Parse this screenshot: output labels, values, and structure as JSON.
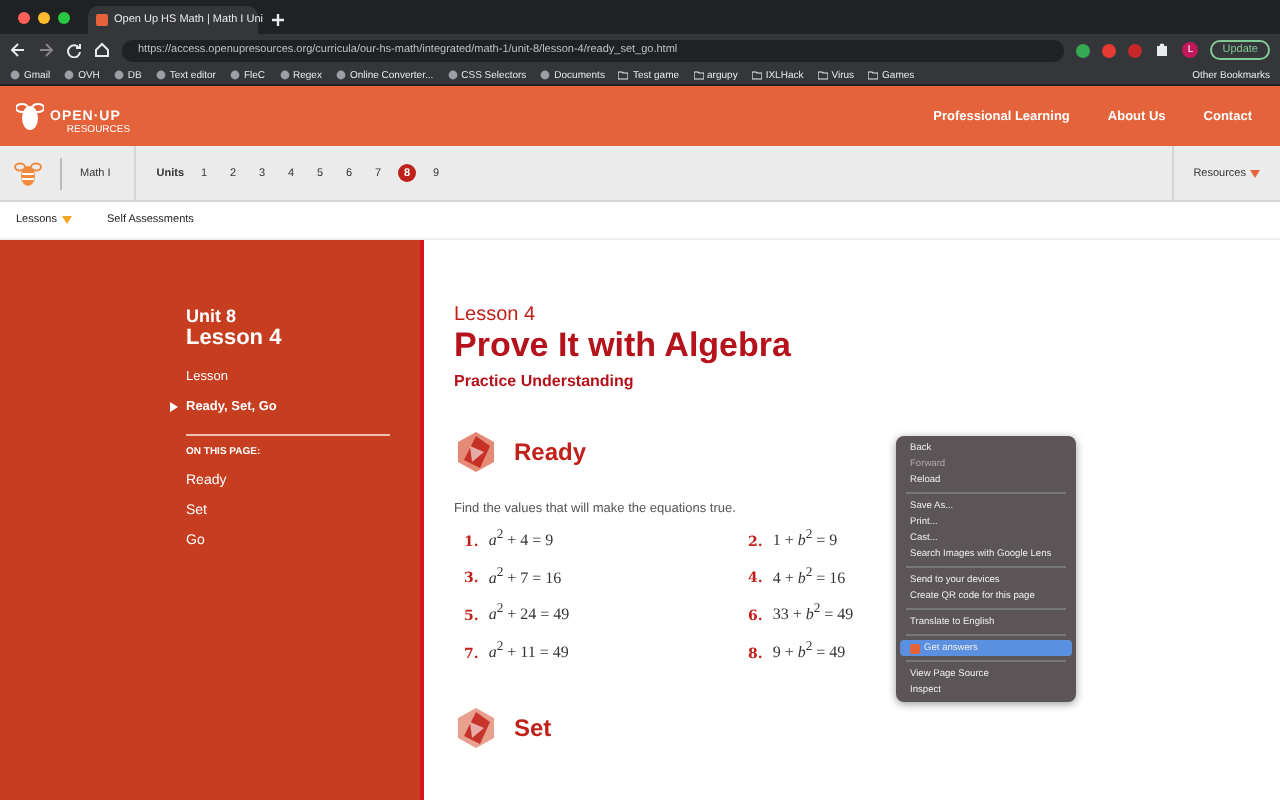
{
  "browser": {
    "tab_title": "Open Up HS Math | Math I Uni",
    "url": "https://access.openupresources.org/curricula/our-hs-math/integrated/math-1/unit-8/lesson-4/ready_set_go.html",
    "update_label": "Update",
    "profile": "L"
  },
  "bookmarks": [
    {
      "label": "Gmail"
    },
    {
      "label": "OVH"
    },
    {
      "label": "DB"
    },
    {
      "label": "Text editor"
    },
    {
      "label": "FleC"
    },
    {
      "label": "Regex"
    },
    {
      "label": "Online Converter..."
    },
    {
      "label": "CSS Selectors"
    },
    {
      "label": "Documents"
    },
    {
      "label": "Test game",
      "kind": "folder"
    },
    {
      "label": "argupy",
      "kind": "folder"
    },
    {
      "label": "IXLHack",
      "kind": "folder"
    },
    {
      "label": "Virus",
      "kind": "folder"
    },
    {
      "label": "Games",
      "kind": "folder"
    }
  ],
  "other_bookmarks": "Other Bookmarks",
  "header": {
    "logo": "OPEN·UP",
    "logo_sub": "RESOURCES",
    "nav": [
      "Professional Learning",
      "About Us",
      "Contact"
    ]
  },
  "course": {
    "name": "Math I",
    "units_label": "Units",
    "units": [
      {
        "label": "1",
        "selected": false
      },
      {
        "label": "2",
        "selected": false
      },
      {
        "label": "3",
        "selected": false
      },
      {
        "label": "4",
        "selected": false
      },
      {
        "label": "5",
        "selected": false
      },
      {
        "label": "6",
        "selected": false
      },
      {
        "label": "7",
        "selected": false
      },
      {
        "label": "8",
        "selected": true
      },
      {
        "label": "9",
        "selected": false
      }
    ],
    "resources": "Resources"
  },
  "subnav": [
    "Lessons",
    "Self Assessments"
  ],
  "sidebar": {
    "unit": "Unit 8",
    "lesson": "Lesson 4",
    "links": [
      {
        "label": "Lesson",
        "selected": false
      },
      {
        "label": "Ready, Set, Go",
        "selected": true
      }
    ],
    "on_this_page": "ON THIS PAGE:",
    "anchors": [
      "Ready",
      "Set",
      "Go"
    ]
  },
  "main": {
    "eyebrow": "Lesson 4",
    "title": "Prove It with Algebra",
    "subtitle": "Practice Understanding",
    "sections": [
      {
        "heading": "Ready",
        "instruction": "Find the values that will make the equations true.",
        "problems": [
          {
            "number": "1.",
            "equation": "*a*$^{2}$ + 4 = 9"
          },
          {
            "number": "2.",
            "equation": "1 + *b*$^{2}$ = 9"
          },
          {
            "number": "3.",
            "equation": "*a*$^{2}$ + 7 = 16"
          },
          {
            "number": "4.",
            "equation": "4 + *b*$^{2}$ = 16"
          },
          {
            "number": "5.",
            "equation": "*a*$^{2}$ + 24 = 49"
          },
          {
            "number": "6.",
            "equation": "33 + *b*$^{2}$ = 49"
          },
          {
            "number": "7.",
            "equation": "*a*$^{2}$ + 11 = 49"
          },
          {
            "number": "8.",
            "equation": "9 + *b*$^{2}$ = 49"
          }
        ]
      },
      {
        "heading": "Set"
      }
    ]
  },
  "context_menu": [
    [
      {
        "label": "Back",
        "disabled": false
      },
      {
        "label": "Forward",
        "disabled": true
      },
      {
        "label": "Reload",
        "disabled": false
      }
    ],
    [
      {
        "label": "Save As...",
        "disabled": false
      },
      {
        "label": "Print...",
        "disabled": false
      },
      {
        "label": "Cast...",
        "disabled": false
      },
      {
        "label": "Search Images with Google Lens",
        "disabled": false
      }
    ],
    [
      {
        "label": "Send to your devices",
        "disabled": false
      },
      {
        "label": "Create QR code for this page",
        "disabled": false
      }
    ],
    [
      {
        "label": "Translate to English",
        "disabled": false
      }
    ],
    [
      {
        "label": "Get answers",
        "disabled": false,
        "selected": true
      }
    ],
    [
      {
        "label": "View Page Source",
        "disabled": false
      },
      {
        "label": "Inspect",
        "disabled": false
      }
    ]
  ]
}
